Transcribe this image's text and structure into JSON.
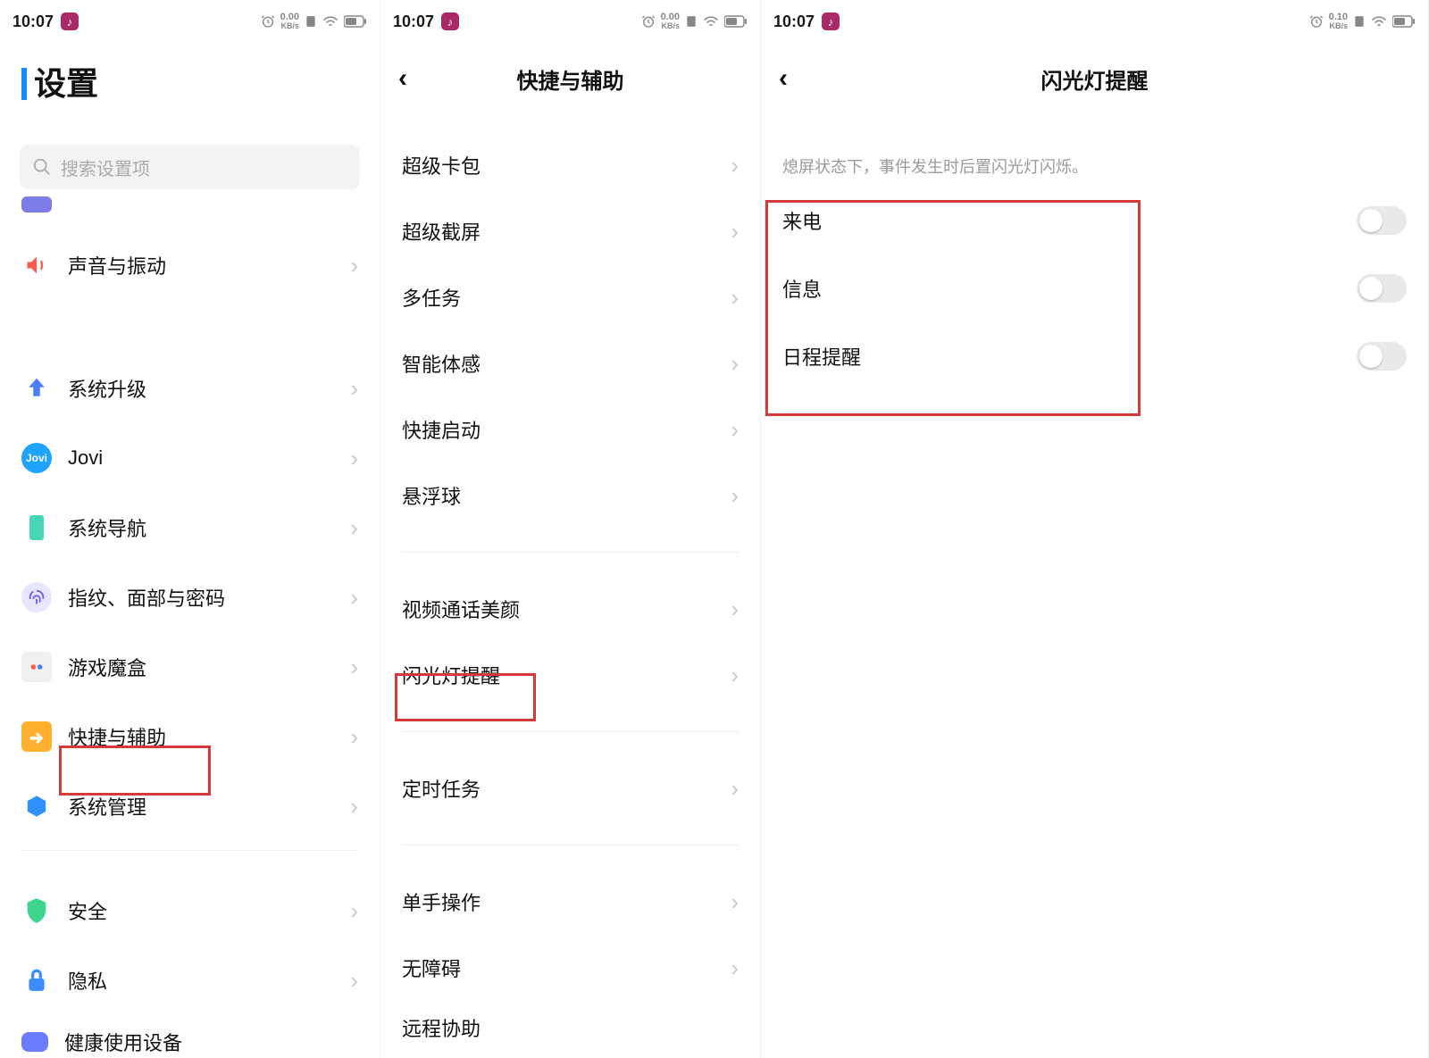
{
  "status": {
    "time": "10:07",
    "speed1": "0.00",
    "speed2": "0.10",
    "speed_unit": "KB/s"
  },
  "panel1": {
    "title": "设置",
    "search_placeholder": "搜索设置项",
    "items": [
      {
        "label": "声音与振动"
      },
      {
        "label": "系统升级"
      },
      {
        "label": "Jovi"
      },
      {
        "label": "系统导航"
      },
      {
        "label": "指纹、面部与密码"
      },
      {
        "label": "游戏魔盒"
      },
      {
        "label": "快捷与辅助"
      },
      {
        "label": "系统管理"
      },
      {
        "label": "安全"
      },
      {
        "label": "隐私"
      },
      {
        "label": "健康使用设备"
      }
    ]
  },
  "panel2": {
    "title": "快捷与辅助",
    "groups": {
      "a": [
        {
          "label": "超级卡包"
        },
        {
          "label": "超级截屏"
        },
        {
          "label": "多任务"
        },
        {
          "label": "智能体感"
        },
        {
          "label": "快捷启动"
        },
        {
          "label": "悬浮球"
        }
      ],
      "b": [
        {
          "label": "视频通话美颜"
        },
        {
          "label": "闪光灯提醒"
        }
      ],
      "c": [
        {
          "label": "定时任务"
        }
      ],
      "d": [
        {
          "label": "单手操作"
        },
        {
          "label": "无障碍"
        },
        {
          "label": "远程协助"
        }
      ]
    }
  },
  "panel3": {
    "title": "闪光灯提醒",
    "desc": "熄屏状态下，事件发生时后置闪光灯闪烁。",
    "toggles": [
      {
        "label": "来电"
      },
      {
        "label": "信息"
      },
      {
        "label": "日程提醒"
      }
    ]
  }
}
